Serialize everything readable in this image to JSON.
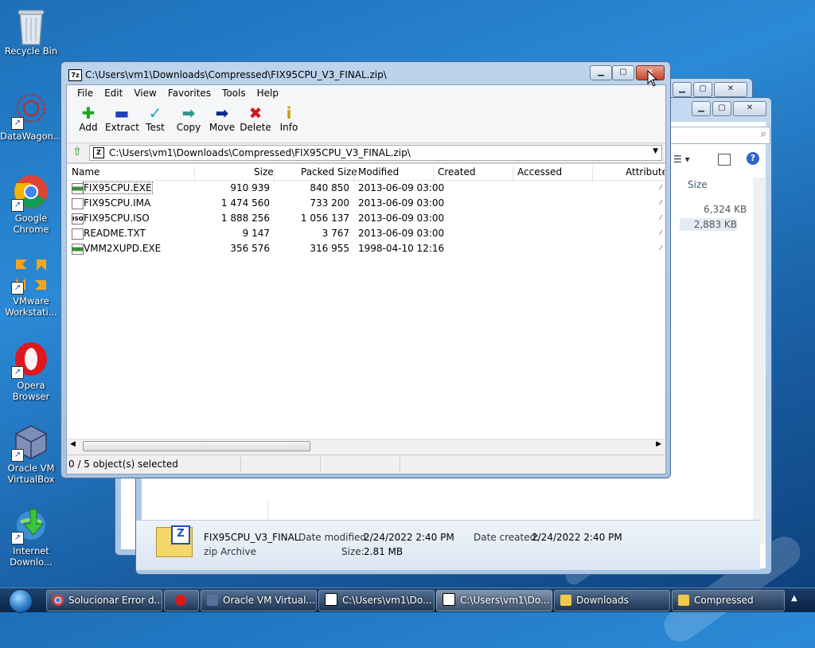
{
  "desktop_icons": [
    {
      "label_line1": "Recycle Bin",
      "label_line2": ""
    },
    {
      "label_line1": "DataWagon...",
      "label_line2": ""
    },
    {
      "label_line1": "Google",
      "label_line2": "Chrome"
    },
    {
      "label_line1": "VMware",
      "label_line2": "Workstati..."
    },
    {
      "label_line1": "Opera",
      "label_line2": "Browser"
    },
    {
      "label_line1": "Oracle VM",
      "label_line2": "VirtualBox"
    },
    {
      "label_line1": "Internet",
      "label_line2": "Downlo..."
    }
  ],
  "window": {
    "title": "C:\\Users\\vm1\\Downloads\\Compressed\\FIX95CPU_V3_FINAL.zip\\",
    "app_badge": "7z",
    "caption_buttons": {
      "minimize": "▁",
      "maximize": "▢",
      "close": "✕"
    },
    "menu": [
      "File",
      "Edit",
      "View",
      "Favorites",
      "Tools",
      "Help"
    ],
    "toolbar": [
      {
        "label": "Add",
        "glyph": "✚",
        "color": "#1aa81a"
      },
      {
        "label": "Extract",
        "glyph": "▬",
        "color": "#1f3fb8"
      },
      {
        "label": "Test",
        "glyph": "✓",
        "color": "#18a8c0"
      },
      {
        "label": "Copy",
        "glyph": "➡",
        "color": "#2a9a8a"
      },
      {
        "label": "Move",
        "glyph": "➡",
        "color": "#0d2a8a"
      },
      {
        "label": "Delete",
        "glyph": "✖",
        "color": "#d01818"
      },
      {
        "label": "Info",
        "glyph": "i",
        "color": "#c8a010"
      }
    ],
    "address": "C:\\Users\\vm1\\Downloads\\Compressed\\FIX95CPU_V3_FINAL.zip\\",
    "columns": [
      "Name",
      "Size",
      "Packed Size",
      "Modified",
      "Created",
      "Accessed",
      "Attribute"
    ],
    "files": [
      {
        "name": "FIX95CPU.EXE",
        "size": "910 939",
        "packed": "840 850",
        "modified": "2013-06-09 03:00",
        "type": "exe"
      },
      {
        "name": "FIX95CPU.IMA",
        "size": "1 474 560",
        "packed": "733 200",
        "modified": "2013-06-09 03:00",
        "type": "doc"
      },
      {
        "name": "FIX95CPU.ISO",
        "size": "1 888 256",
        "packed": "1 056 137",
        "modified": "2013-06-09 03:00",
        "type": "iso"
      },
      {
        "name": "README.TXT",
        "size": "9 147",
        "packed": "3 767",
        "modified": "2013-06-09 03:00",
        "type": "doc"
      },
      {
        "name": "VMM2XUPD.EXE",
        "size": "356 576",
        "packed": "316 955",
        "modified": "1998-04-10 12:16",
        "type": "exe"
      }
    ],
    "status": "0 / 5 object(s) selected"
  },
  "explorer": {
    "size_header": "Size",
    "sizes": [
      "6,324 KB",
      "2,883 KB"
    ],
    "details": {
      "name": "FIX95CPU_V3_FINAL",
      "type": "zip Archive",
      "modified_label": "Date modified:",
      "modified": "2/24/2022 2:40 PM",
      "created_label": "Date created:",
      "created": "2/24/2022 2:40 PM",
      "size_label": "Size:",
      "size": "2.81 MB"
    }
  },
  "taskbar": [
    {
      "label": "Solucionar Error d...",
      "color": "#e8b030"
    },
    {
      "label": "",
      "color": "#d81c1c"
    },
    {
      "label": "Oracle VM Virtual...",
      "color": "#5a6e9a"
    },
    {
      "label": "C:\\Users\\vm1\\Do...",
      "color": "#ffffff"
    },
    {
      "label": "C:\\Users\\vm1\\Do...",
      "color": "#ffffff"
    },
    {
      "label": "Downloads",
      "color": "#f0c84a"
    },
    {
      "label": "Compressed",
      "color": "#f0c84a"
    }
  ],
  "tray_arrow": "▲"
}
